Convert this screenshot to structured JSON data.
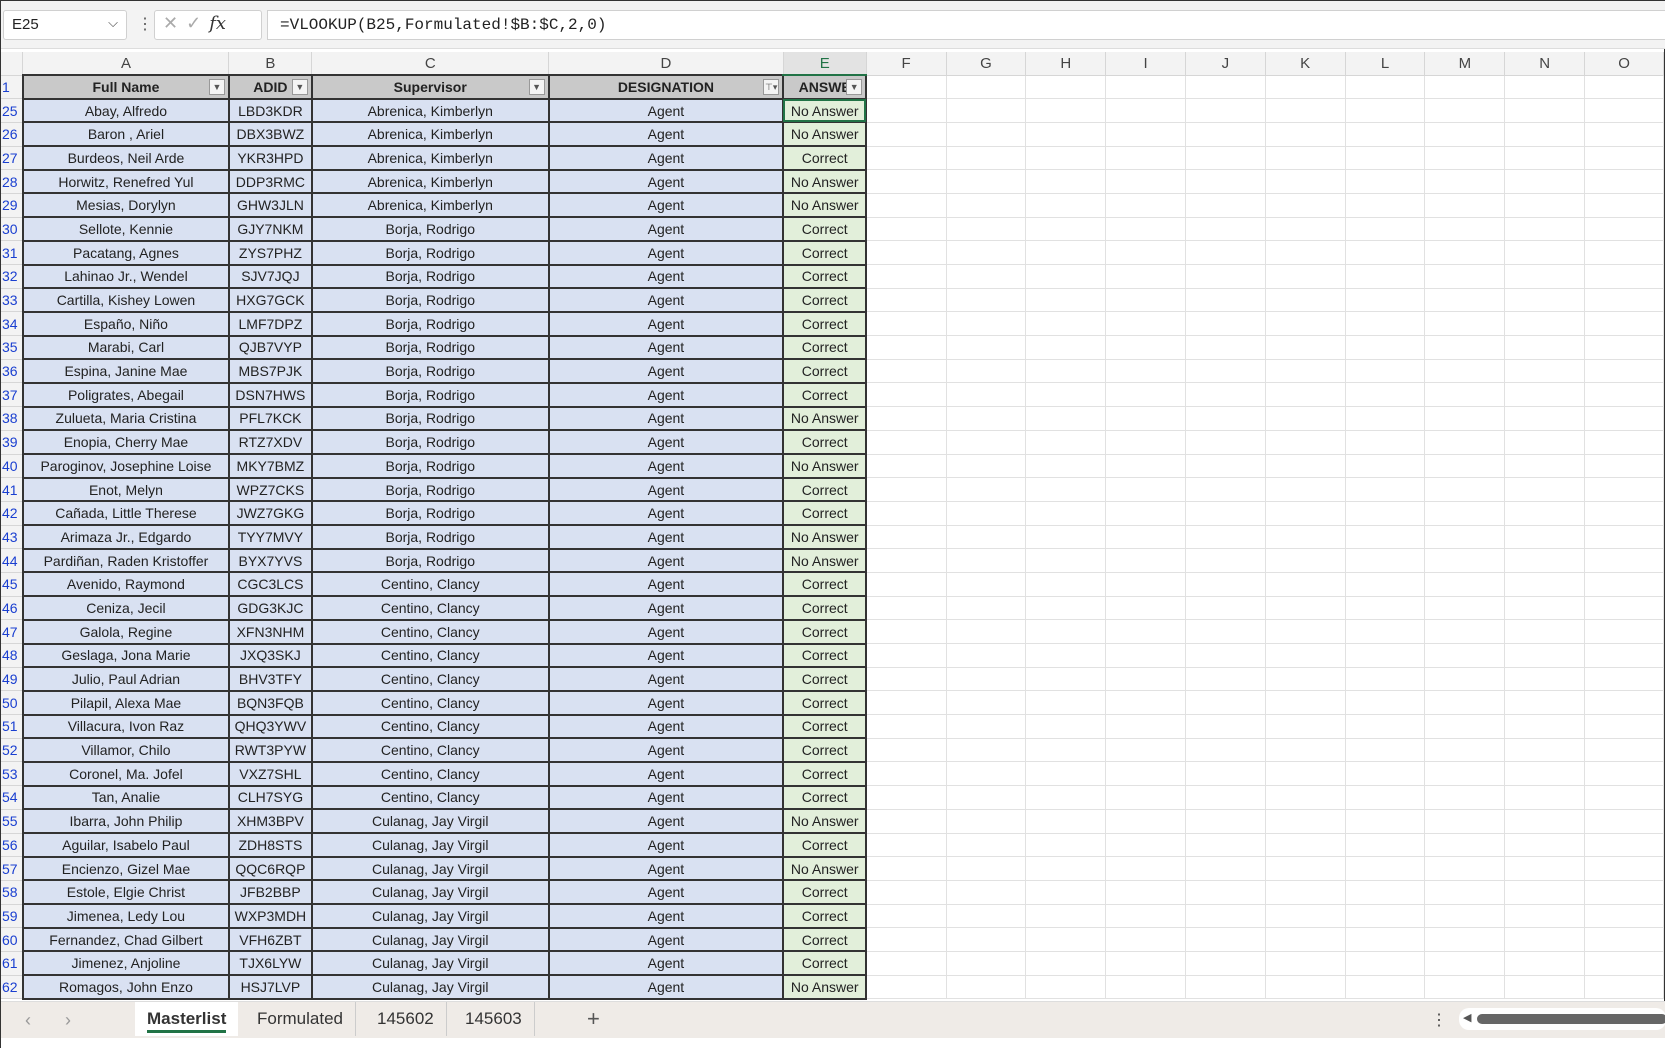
{
  "formula_bar": {
    "name_box": "E25",
    "formula": "=VLOOKUP(B25,Formulated!$B:$C,2,0)",
    "fx": "fx"
  },
  "columns": [
    "A",
    "B",
    "C",
    "D",
    "E",
    "F",
    "G",
    "H",
    "I",
    "J",
    "K",
    "L",
    "M",
    "N",
    "O"
  ],
  "header_row_number": "1",
  "headers": [
    "Full Name",
    "ADID",
    "Supervisor",
    "DESIGNATION",
    "ANSWE"
  ],
  "rows": [
    [
      "25",
      "Abay, Alfredo",
      "LBD3KDR",
      "Abrenica, Kimberlyn",
      "Agent",
      "No Answer"
    ],
    [
      "26",
      "Baron , Ariel",
      "DBX3BWZ",
      "Abrenica, Kimberlyn",
      "Agent",
      "No Answer"
    ],
    [
      "27",
      "Burdeos, Neil Arde",
      "YKR3HPD",
      "Abrenica, Kimberlyn",
      "Agent",
      "Correct"
    ],
    [
      "28",
      "Horwitz, Renefred Yul",
      "DDP3RMC",
      "Abrenica, Kimberlyn",
      "Agent",
      "No Answer"
    ],
    [
      "29",
      "Mesias, Dorylyn",
      "GHW3JLN",
      "Abrenica, Kimberlyn",
      "Agent",
      "No Answer"
    ],
    [
      "30",
      "Sellote, Kennie",
      "GJY7NKM",
      "Borja, Rodrigo",
      "Agent",
      "Correct"
    ],
    [
      "31",
      "Pacatang, Agnes",
      "ZYS7PHZ",
      "Borja, Rodrigo",
      "Agent",
      "Correct"
    ],
    [
      "32",
      "Lahinao Jr., Wendel",
      "SJV7JQJ",
      "Borja, Rodrigo",
      "Agent",
      "Correct"
    ],
    [
      "33",
      "Cartilla, Kishey Lowen",
      "HXG7GCK",
      "Borja, Rodrigo",
      "Agent",
      "Correct"
    ],
    [
      "34",
      "Españo, Niño",
      "LMF7DPZ",
      "Borja, Rodrigo",
      "Agent",
      "Correct"
    ],
    [
      "35",
      "Marabi, Carl",
      "QJB7VYP",
      "Borja, Rodrigo",
      "Agent",
      "Correct"
    ],
    [
      "36",
      "Espina, Janine Mae",
      "MBS7PJK",
      "Borja, Rodrigo",
      "Agent",
      "Correct"
    ],
    [
      "37",
      "Poligrates, Abegail",
      "DSN7HWS",
      "Borja, Rodrigo",
      "Agent",
      "Correct"
    ],
    [
      "38",
      "Zulueta, Maria Cristina",
      "PFL7KCK",
      "Borja, Rodrigo",
      "Agent",
      "No Answer"
    ],
    [
      "39",
      "Enopia, Cherry Mae",
      "RTZ7XDV",
      "Borja, Rodrigo",
      "Agent",
      "Correct"
    ],
    [
      "40",
      "Paroginov, Josephine Loise",
      "MKY7BMZ",
      "Borja, Rodrigo",
      "Agent",
      "No Answer"
    ],
    [
      "41",
      "Enot, Melyn",
      "WPZ7CKS",
      "Borja, Rodrigo",
      "Agent",
      "Correct"
    ],
    [
      "42",
      "Cañada, Little Therese",
      "JWZ7GKG",
      "Borja, Rodrigo",
      "Agent",
      "Correct"
    ],
    [
      "43",
      "Arimaza Jr., Edgardo",
      "TYY7MVY",
      "Borja, Rodrigo",
      "Agent",
      "No Answer"
    ],
    [
      "44",
      "Pardiñan, Raden Kristoffer",
      "BYX7YVS",
      "Borja, Rodrigo",
      "Agent",
      "No Answer"
    ],
    [
      "45",
      "Avenido, Raymond",
      "CGC3LCS",
      "Centino, Clancy",
      "Agent",
      "Correct"
    ],
    [
      "46",
      "Ceniza, Jecil",
      "GDG3KJC",
      "Centino, Clancy",
      "Agent",
      "Correct"
    ],
    [
      "47",
      "Galola, Regine",
      "XFN3NHM",
      "Centino, Clancy",
      "Agent",
      "Correct"
    ],
    [
      "48",
      "Geslaga, Jona Marie",
      "JXQ3SKJ",
      "Centino, Clancy",
      "Agent",
      "Correct"
    ],
    [
      "49",
      "Julio, Paul Adrian",
      "BHV3TFY",
      "Centino, Clancy",
      "Agent",
      "Correct"
    ],
    [
      "50",
      "Pilapil, Alexa Mae",
      "BQN3FQB",
      "Centino, Clancy",
      "Agent",
      "Correct"
    ],
    [
      "51",
      "Villacura, Ivon Raz",
      "QHQ3YWV",
      "Centino, Clancy",
      "Agent",
      "Correct"
    ],
    [
      "52",
      "Villamor, Chilo",
      "RWT3PYW",
      "Centino, Clancy",
      "Agent",
      "Correct"
    ],
    [
      "53",
      "Coronel, Ma. Jofel",
      "VXZ7SHL",
      "Centino, Clancy",
      "Agent",
      "Correct"
    ],
    [
      "54",
      "Tan, Analie",
      "CLH7SYG",
      "Centino, Clancy",
      "Agent",
      "Correct"
    ],
    [
      "55",
      "Ibarra, John Philip",
      "XHM3BPV",
      "Culanag, Jay Virgil",
      "Agent",
      "No Answer"
    ],
    [
      "56",
      "Aguilar, Isabelo Paul",
      "ZDH8STS",
      "Culanag, Jay Virgil",
      "Agent",
      "Correct"
    ],
    [
      "57",
      "Encienzo, Gizel Mae",
      "QQC6RQP",
      "Culanag, Jay Virgil",
      "Agent",
      "No Answer"
    ],
    [
      "58",
      "Estole, Elgie Christ",
      "JFB2BBP",
      "Culanag, Jay Virgil",
      "Agent",
      "Correct"
    ],
    [
      "59",
      "Jimenea, Ledy Lou",
      "WXP3MDH",
      "Culanag, Jay Virgil",
      "Agent",
      "Correct"
    ],
    [
      "60",
      "Fernandez, Chad Gilbert",
      "VFH6ZBT",
      "Culanag, Jay Virgil",
      "Agent",
      "Correct"
    ],
    [
      "61",
      "Jimenez, Anjoline",
      "TJX6LYW",
      "Culanag, Jay Virgil",
      "Agent",
      "Correct"
    ],
    [
      "62",
      "Romagos, John Enzo",
      "HSJ7LVP",
      "Culanag, Jay Virgil",
      "Agent",
      "No Answer"
    ]
  ],
  "sheet_tabs": [
    "Masterlist",
    "Formulated",
    "145602",
    "145603"
  ],
  "active_tab": "Masterlist",
  "colors": {
    "table_fill": "#d9e1f2",
    "answer_fill": "#e2efda",
    "accent": "#217346"
  }
}
